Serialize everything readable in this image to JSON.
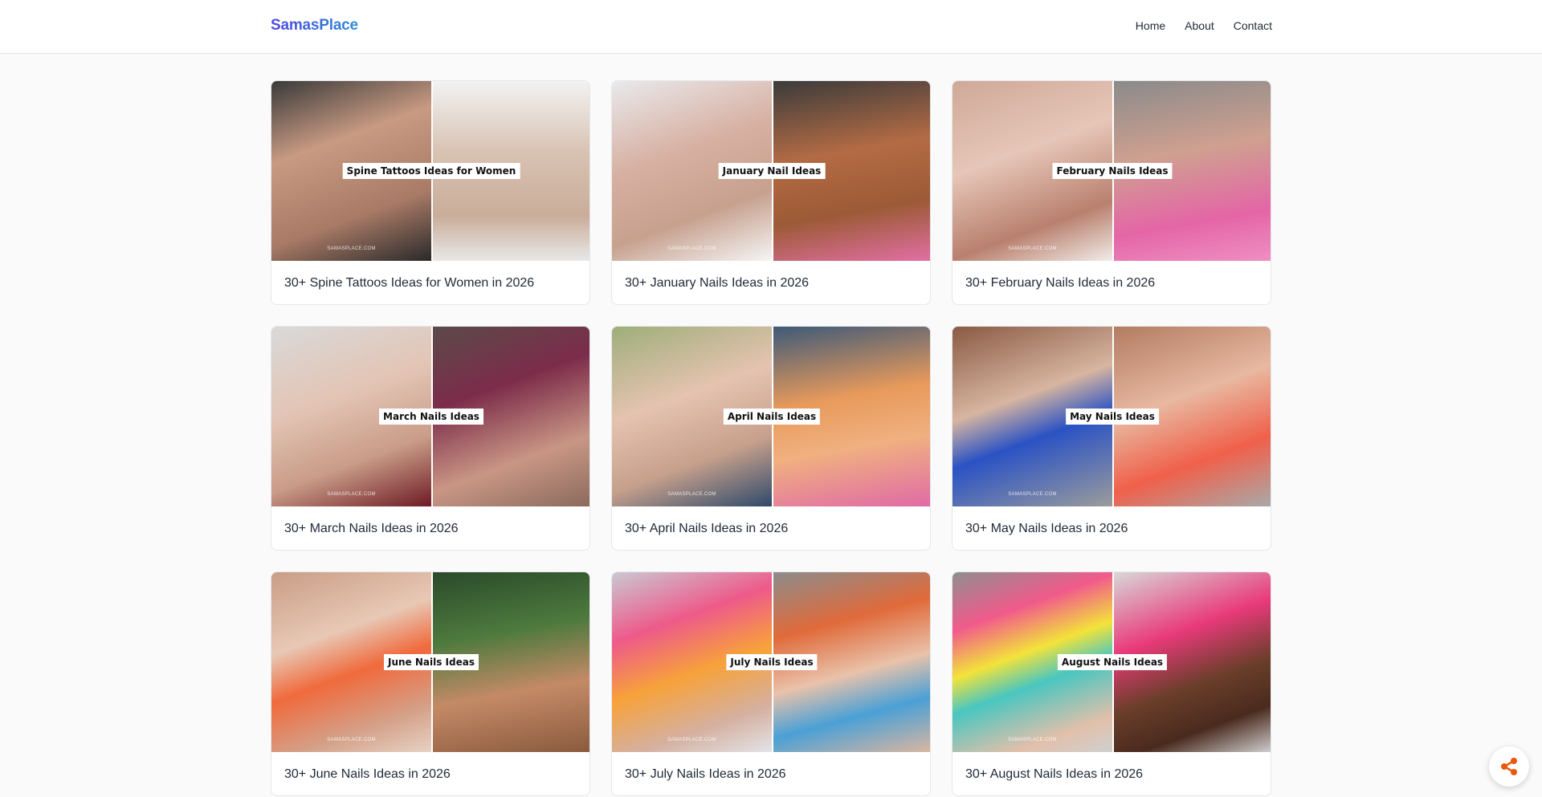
{
  "header": {
    "logo": "SamasPlace",
    "nav": [
      {
        "label": "Home"
      },
      {
        "label": "About"
      },
      {
        "label": "Contact"
      }
    ]
  },
  "watermark": "SAMASPLACE.COM",
  "cards": [
    {
      "overlay": "Spine Tattoos Ideas for Women",
      "title": "30+ Spine Tattoos Ideas for Women in 2026"
    },
    {
      "overlay": "January Nail Ideas",
      "title": "30+ January Nails Ideas in 2026"
    },
    {
      "overlay": "February Nails Ideas",
      "title": "30+ February Nails Ideas in 2026"
    },
    {
      "overlay": "March Nails Ideas",
      "title": "30+ March Nails Ideas in 2026"
    },
    {
      "overlay": "April Nails Ideas",
      "title": "30+ April Nails Ideas in 2026"
    },
    {
      "overlay": "May Nails Ideas",
      "title": "30+ May Nails Ideas in 2026"
    },
    {
      "overlay": "June Nails Ideas",
      "title": "30+ June Nails Ideas in 2026"
    },
    {
      "overlay": "July Nails Ideas",
      "title": "30+ July Nails Ideas in 2026"
    },
    {
      "overlay": "August Nails Ideas",
      "title": "30+ August Nails Ideas in 2026"
    }
  ],
  "share_icon": "share-icon",
  "colors": {
    "logo_gradient_start": "#4f46e5",
    "logo_gradient_end": "#2d8cd6",
    "share_accent": "#ea580c"
  }
}
